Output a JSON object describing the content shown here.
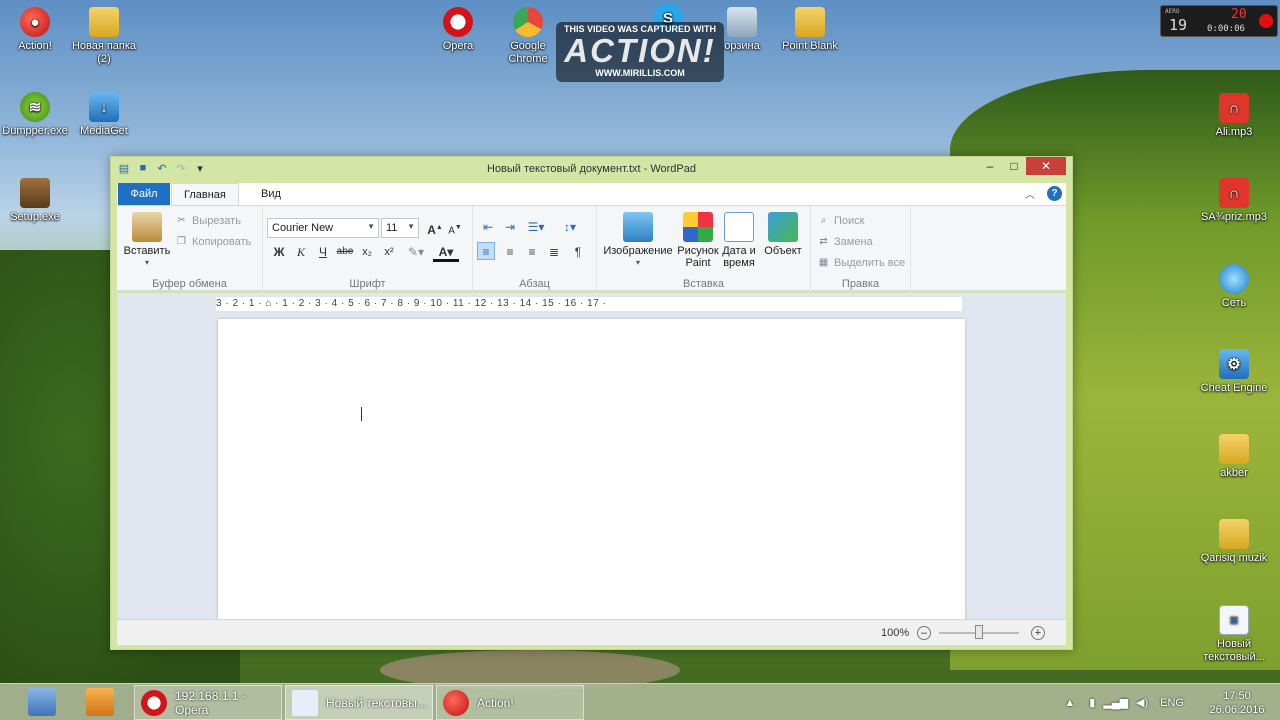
{
  "desktop": {
    "icons": [
      {
        "label": "Action!"
      },
      {
        "label": "Новая папка (2)"
      },
      {
        "label": "Dumpper.exe"
      },
      {
        "label": "MediaGet"
      },
      {
        "label": "Setup.exe"
      },
      {
        "label": "Opera"
      },
      {
        "label": "Google Chrome"
      },
      {
        "label": "орзина"
      },
      {
        "label": "Point Blank"
      },
      {
        "label": "Ali.mp3"
      },
      {
        "label": "SÄ¾priz.mp3"
      },
      {
        "label": "Сеть"
      },
      {
        "label": "Cheat Engine"
      },
      {
        "label": "akber"
      },
      {
        "label": "Qarisiq muzik"
      },
      {
        "label": "Новый текстовый..."
      }
    ]
  },
  "watermark": {
    "line1": "THIS VIDEO WAS CAPTURED WITH",
    "logo": "ACTION!",
    "url": "WWW.MIRILLIS.COM"
  },
  "recorder": {
    "aero": "AERO",
    "fps": "19",
    "counter": "20",
    "timer": "0:00:06"
  },
  "wordpad": {
    "title": "Новый текстовый документ.txt - WordPad",
    "tabs": {
      "file": "Файл",
      "home": "Главная",
      "view": "Вид"
    },
    "clipboard": {
      "paste": "Вставить",
      "cut": "Вырезать",
      "copy": "Копировать",
      "group": "Буфер обмена"
    },
    "font": {
      "family": "Courier New",
      "size": "11",
      "group": "Шрифт",
      "bold": "Ж",
      "italic": "К",
      "underline": "Ч",
      "strike": "abe",
      "sub": "x₂",
      "sup": "x²"
    },
    "paragraph": {
      "group": "Абзац"
    },
    "insert": {
      "image": "Изображение",
      "paint": "Рисунок Paint",
      "datetime": "Дата и время",
      "object": "Объект",
      "group": "Вставка"
    },
    "editing": {
      "find": "Поиск",
      "replace": "Замена",
      "select_all": "Выделить все",
      "group": "Правка"
    },
    "ruler": "3 · 2 · 1 · ⌂ · 1 · 2 · 3 · 4 · 5 · 6 · 7 · 8 · 9 · 10 · 11 · 12 · 13 · 14 · 15 · 16 · 17 ·",
    "zoom": "100%"
  },
  "taskbar": {
    "tasks": [
      {
        "label": "192.168.1.1 - Opera"
      },
      {
        "label": "Новый текстовы..."
      },
      {
        "label": "Action!"
      }
    ],
    "lang": "ENG",
    "time": "17:50",
    "date": "26.06.2016"
  }
}
